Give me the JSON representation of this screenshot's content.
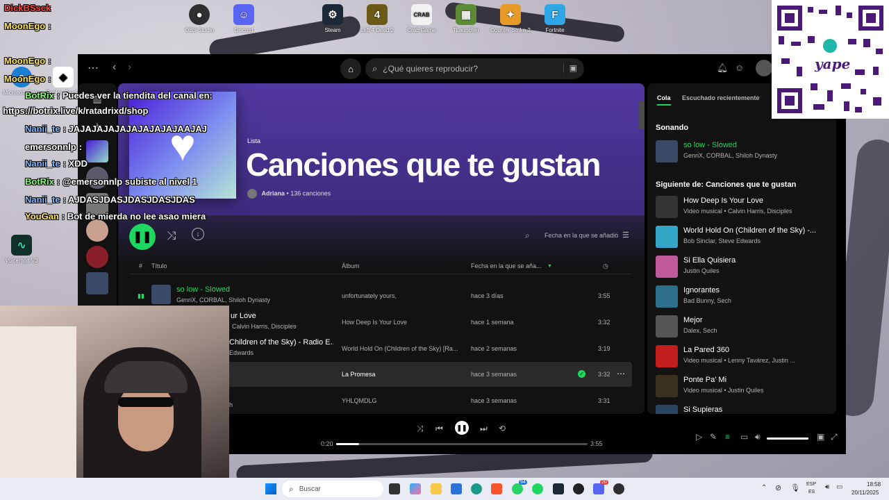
{
  "desktop": {
    "icons": [
      {
        "label": "OBS Studio"
      },
      {
        "label": "Discord"
      },
      {
        "label": "Steam"
      },
      {
        "label": "Left 4 Dead 2"
      },
      {
        "label": "Crab Game"
      },
      {
        "label": "TLauncher"
      },
      {
        "label": "Counter Strike 2"
      },
      {
        "label": "Fortnite"
      },
      {
        "label": "Microsoft Edge"
      },
      {
        "label": "Roblox Studio"
      },
      {
        "label": "Voicemod V3"
      }
    ]
  },
  "spotify": {
    "search_placeholder": "¿Qué quieres reproducir?",
    "playlist": {
      "type_label": "Lista",
      "title": "Canciones que te gustan",
      "owner": "Adriana",
      "count": "• 136 canciones"
    },
    "sort_label": "Fecha en la que se añadió",
    "columns": {
      "num": "#",
      "title": "Título",
      "album": "Álbum",
      "date": "Fecha en la que se aña..."
    },
    "tracks": [
      {
        "title": "so low - Slowed",
        "artists": "GenriX, CORBAL, Shiloh Dynasty",
        "album": "unfortunately yours,",
        "date": "hace 3 días",
        "duration": "3:55"
      },
      {
        "title": "ur Love",
        "artists": "Calvin Harris, Disciples",
        "album": "How Deep Is Your Love",
        "date": "hace 1 semana",
        "duration": "3:32"
      },
      {
        "title": "Children of the Sky) - Radio E...",
        "artists": "Edwards",
        "album": "World Hold On (Children of the Sky) [Ra...",
        "date": "hace 2 semanas",
        "duration": "3:19"
      },
      {
        "title": "",
        "artists": "",
        "album": "La Promesa",
        "date": "hace 3 semanas",
        "duration": "3:32"
      },
      {
        "title": "",
        "artists": "h",
        "album": "YHLQMDLG",
        "date": "hace 3 semanas",
        "duration": "3:31"
      }
    ],
    "queue": {
      "tab_queue": "Cola",
      "tab_recent": "Escuchado recientemente",
      "now_playing_heading": "Sonando",
      "now_playing": {
        "title": "so low - Slowed",
        "artists": "GenriX, CORBAL, Shiloh Dynasty"
      },
      "next_heading": "Siguiente de: Canciones que te gustan",
      "items": [
        {
          "title": "How Deep Is Your Love",
          "sub": "Video musical • Calvin Harris, Disciples",
          "color": "#333333"
        },
        {
          "title": "World Hold On (Children of the Sky) -...",
          "sub": "Bob Sinclar, Steve Edwards",
          "color": "#33a6c7"
        },
        {
          "title": "Si Ella Quisiera",
          "sub": "Justin Quiles",
          "color": "#c05a9a"
        },
        {
          "title": "Ignorantes",
          "sub": "Bad Bunny, Sech",
          "color": "#2c6f8d"
        },
        {
          "title": "Mejor",
          "sub": "Dalex, Sech",
          "color": "#555555"
        },
        {
          "title": "La Pared 360",
          "sub": "Video musical • Lenny Tavárez, Justin ...",
          "color": "#c41d1d"
        },
        {
          "title": "Ponte Pa' Mi",
          "sub": "Video musical • Justin Quiles",
          "color": "#3a3020"
        },
        {
          "title": "Si Supieras",
          "sub": "",
          "color": "#2a4660"
        }
      ]
    },
    "player": {
      "elapsed": "0:20",
      "total": "3:55",
      "progress": 0.09,
      "volume": 1.0
    },
    "accent": "#1ed760"
  },
  "chat": [
    {
      "user": "DickBSsck",
      "msg": ""
    },
    {
      "user": "MoonEgo",
      "msg": ":"
    },
    {
      "user": "MoonEgo",
      "msg": ":"
    },
    {
      "user": "MoonEgo",
      "msg": ":"
    },
    {
      "user": "BotRix",
      "msg": ": Puedes ver la tiendita del canal en:"
    },
    {
      "user": "",
      "msg": "https://botrix.live/k/ratadrixd/shop"
    },
    {
      "user": "Nanii_te",
      "msg": ": JAJAJAJAJAJAJAJAJAJAAJAJ"
    },
    {
      "user": "emersonnlp",
      "msg": ":"
    },
    {
      "user": "Nanii_te",
      "msg": ": XDD"
    },
    {
      "user": "BotRix",
      "msg": ": @emersonnlp subiste al nivel 1"
    },
    {
      "user": "Nanii_te",
      "msg": ": AJDASJDASJDASJDASJDAS"
    },
    {
      "user": "YouGan",
      "msg": ": Bot de mierda no lee asao miera"
    }
  ],
  "taskbar": {
    "search_placeholder": "Buscar",
    "lang": "ESP",
    "lang_sub": "ES",
    "time": "18:58",
    "date": "20/11/2025",
    "badge_whatsapp": "94",
    "badge_discord": "20"
  },
  "qr_brand": "yape"
}
